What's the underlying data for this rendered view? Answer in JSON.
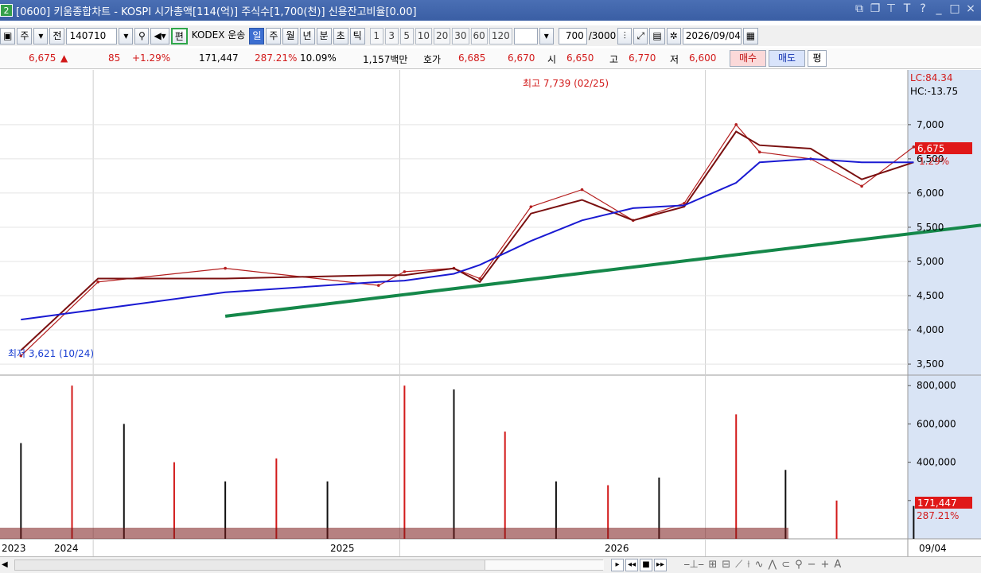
{
  "window": {
    "title": "[0600] 키움종합차트 - KOSPI 시가총액[114(억)] 주식수[1,700(천)] 신용잔고비율[0.00]",
    "icon": "2",
    "controls": [
      "ㅁ",
      "ㅁ",
      "ㅍ",
      "T",
      "?",
      "|",
      "_",
      "ㅁ",
      "×"
    ]
  },
  "toolbar": {
    "period_week": "주",
    "price_type": "전",
    "code": "140710",
    "edit_label": "편",
    "stock_name": "KODEX 운송",
    "period_buttons": [
      {
        "label": "일",
        "active": true
      },
      {
        "label": "주",
        "active": false
      },
      {
        "label": "월",
        "active": false
      },
      {
        "label": "년",
        "active": false
      },
      {
        "label": "분",
        "active": false
      },
      {
        "label": "초",
        "active": false
      },
      {
        "label": "틱",
        "active": false
      }
    ],
    "interval_buttons": [
      "1",
      "3",
      "5",
      "10",
      "20",
      "30",
      "60",
      "120"
    ],
    "count_display": "700",
    "count_max": "/3000",
    "date": "2026/09/04"
  },
  "quote": {
    "price": "6,675",
    "arrow": "▲",
    "change": "85",
    "change_pct": "+1.29%",
    "volume": "171,447",
    "volume_ratio": "287.21%",
    "turnover": "10.09%",
    "amount": "1,157백만",
    "ask_label": "호가",
    "ask1": "6,685",
    "ask2": "6,670",
    "open_label": "시",
    "open": "6,650",
    "high_label": "고",
    "high": "6,770",
    "low_label": "저",
    "low": "6,600",
    "buy": "매수",
    "sell": "매도",
    "eval": "평"
  },
  "chart_data": [
    {
      "type": "line",
      "panel": "price",
      "x": [
        "2023-10",
        "2024-01",
        "2024-06",
        "2024-12",
        "2025-01",
        "2025-03",
        "2025-04",
        "2025-06",
        "2025-08",
        "2025-10",
        "2025-12",
        "2026-02",
        "2026-03",
        "2026-05",
        "2026-07",
        "2026-09"
      ],
      "series": [
        {
          "role": "price",
          "color": "#b41e1e",
          "values": [
            3621,
            4700,
            4900,
            4650,
            4850,
            4900,
            4750,
            5800,
            6050,
            5600,
            5850,
            7000,
            6600,
            6500,
            6100,
            6675
          ]
        },
        {
          "role": "short-ma",
          "color": "#7a1010",
          "values": [
            3700,
            4750,
            4750,
            4800,
            4800,
            4900,
            4700,
            5700,
            5900,
            5600,
            5800,
            6900,
            6700,
            6650,
            6200,
            6450
          ]
        },
        {
          "role": "long-ma",
          "color": "#1a1ad2",
          "values": [
            4150,
            4300,
            4550,
            4700,
            4720,
            4820,
            4950,
            5300,
            5600,
            5780,
            5820,
            6150,
            6450,
            6500,
            6450,
            6450
          ]
        }
      ],
      "trendline": {
        "start": [
          "2024-06",
          4200
        ],
        "end": [
          "2026-09",
          5530
        ],
        "color": "#15884a"
      },
      "annotations": [
        {
          "text": "최고 7,739 (02/25)",
          "color": "#d21a1a"
        },
        {
          "text": "최저 3,621 (10/24)",
          "color": "#1a3fd1"
        }
      ],
      "y_ticks": [
        "7,000",
        "6,500",
        "6,000",
        "5,500",
        "5,000",
        "4,500",
        "4,000",
        "3,500"
      ],
      "y_tick_values": [
        7000,
        6500,
        6000,
        5500,
        5000,
        4500,
        4000,
        3500
      ],
      "ylim": [
        3350,
        7800
      ],
      "corner_labels": [
        "LC:84.34",
        "HC:-13.75"
      ],
      "current_price_label": "6,675",
      "current_change_label": "1.29%"
    },
    {
      "type": "bar",
      "panel": "volume",
      "x": [
        "2023-10",
        "2023-12",
        "2024-02",
        "2024-04",
        "2024-06",
        "2024-08",
        "2024-10",
        "2025-01",
        "2025-03",
        "2025-05",
        "2025-07",
        "2025-09",
        "2025-11",
        "2026-02",
        "2026-04",
        "2026-06",
        "2026-09"
      ],
      "values": [
        500000,
        800000,
        600000,
        400000,
        300000,
        420000,
        300000,
        800000,
        780000,
        560000,
        300000,
        280000,
        320000,
        650000,
        360000,
        200000,
        171447
      ],
      "y_ticks": [
        "800,000",
        "600,000",
        "400,000",
        "200,000"
      ],
      "y_tick_values": [
        800000,
        600000,
        400000,
        200000
      ],
      "ylim": [
        0,
        830000
      ],
      "current_volume_label": "171,447",
      "current_ratio_label": "287.21%"
    }
  ],
  "x_axis_labels": [
    "2023",
    "2024",
    "2025",
    "2026",
    "09/04"
  ],
  "bottom_controls": [
    "▸",
    "◂◂",
    "■",
    "▸▸"
  ]
}
